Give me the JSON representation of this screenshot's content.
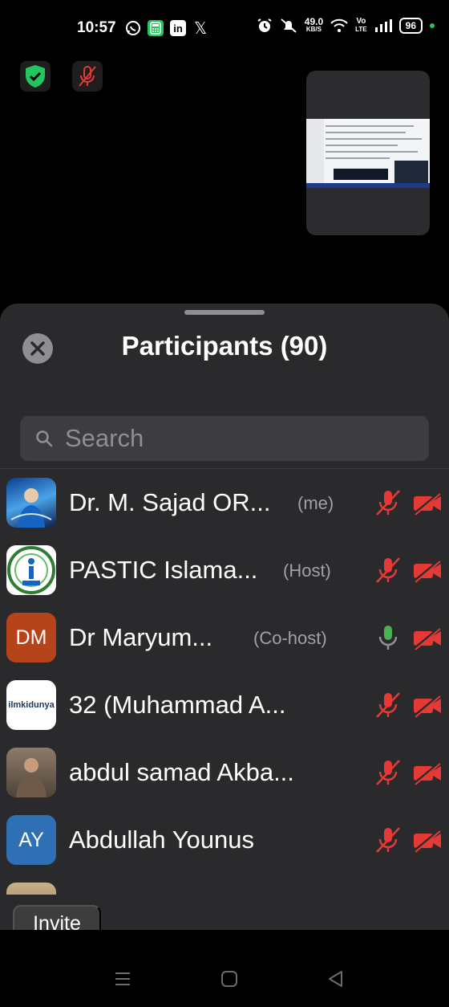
{
  "status_bar": {
    "time": "10:57",
    "left_icons": [
      "whatsapp-icon",
      "calculator-icon",
      "linkedin-icon",
      "x-icon"
    ],
    "speed": "49.0",
    "speed_unit": "KB/S",
    "network_label_top": "Vo",
    "network_label_bottom": "LTE",
    "battery": "96",
    "battery_color": "#ffffff",
    "dot_color": "#22c55e"
  },
  "controls": {
    "shield_icon": "shield-check-icon",
    "shield_color": "#22c55e",
    "mic_icon": "mic-off-icon",
    "mic_off_color": "#e53935"
  },
  "sheet": {
    "title": "Participants (90)",
    "search_placeholder": "Search",
    "invite_label": "Invite"
  },
  "participants": [
    {
      "name": "Dr. M. Sajad OR...",
      "role": "(me)",
      "avatar_type": "photo",
      "avatar_initials": "",
      "mic": "muted",
      "video": "off"
    },
    {
      "name": "PASTIC Islama...",
      "role": "(Host)",
      "avatar_type": "logo",
      "avatar_initials": "",
      "mic": "muted",
      "video": "off"
    },
    {
      "name": "Dr Maryum...",
      "role": "(Co-host)",
      "avatar_type": "initials",
      "avatar_initials": "DM",
      "avatar_color": "#b5441b",
      "mic": "on",
      "video": "off"
    },
    {
      "name": "32 (Muhammad A...",
      "role": "",
      "avatar_type": "logo",
      "avatar_initials": "",
      "avatar_text": "ilmkidunya",
      "mic": "muted",
      "video": "off"
    },
    {
      "name": "abdul samad Akba...",
      "role": "",
      "avatar_type": "photo",
      "avatar_initials": "",
      "mic": "muted",
      "video": "off"
    },
    {
      "name": "Abdullah Younus",
      "role": "",
      "avatar_type": "initials",
      "avatar_initials": "AY",
      "avatar_color": "#2f6fb3",
      "mic": "muted",
      "video": "off"
    }
  ],
  "colors": {
    "muted_red": "#e53935",
    "mic_on_green": "#4caf50",
    "sheet_bg": "#2a2a2c"
  }
}
